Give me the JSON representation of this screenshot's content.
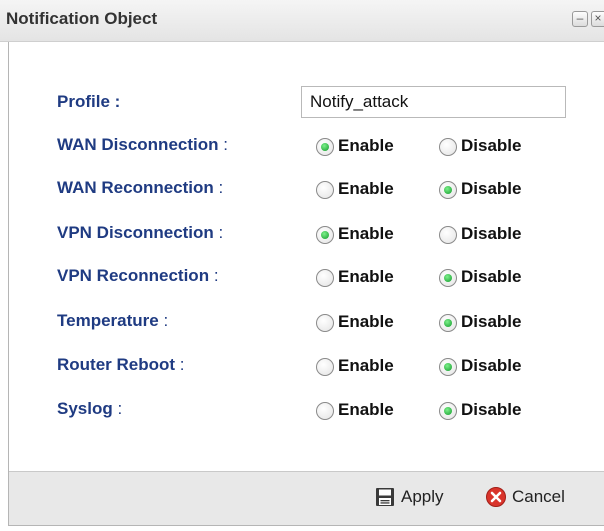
{
  "window": {
    "title": "Notification Object",
    "minimize_symbol": "–",
    "close_symbol": "×"
  },
  "profile": {
    "label": "Profile :",
    "value": "Notify_attack"
  },
  "options": {
    "enable_label": "Enable",
    "disable_label": "Disable"
  },
  "rows": [
    {
      "label": "WAN Disconnection",
      "colon": " :",
      "selected": "enable"
    },
    {
      "label": "WAN Reconnection",
      "colon": " :",
      "selected": "disable"
    },
    {
      "label": "VPN Disconnection",
      "colon": " :",
      "selected": "enable"
    },
    {
      "label": "VPN Reconnection",
      "colon": " :",
      "selected": "disable"
    },
    {
      "label": "Temperature",
      "colon": " :",
      "selected": "disable"
    },
    {
      "label": "Router Reboot",
      "colon": " :",
      "selected": "disable"
    },
    {
      "label": "Syslog",
      "colon": " :",
      "selected": "disable"
    }
  ],
  "footer": {
    "apply_label": "Apply",
    "cancel_label": "Cancel",
    "apply_icon": "save-icon",
    "cancel_icon": "cancel-x-icon"
  },
  "colors": {
    "label_blue": "#1f3b82",
    "radio_checked_green": "#119a2a",
    "cancel_red": "#d9342b"
  }
}
